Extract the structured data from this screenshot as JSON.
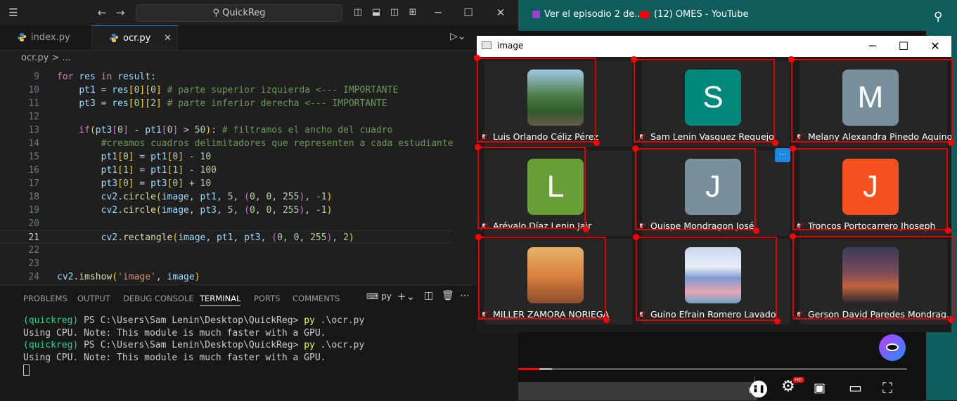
{
  "vscode": {
    "search_text": "QuickReg",
    "tabs": [
      {
        "label": "index.py"
      },
      {
        "label": "ocr.py"
      }
    ],
    "breadcrumb": "ocr.py > ...",
    "line_numbers": [
      "9",
      "10",
      "11",
      "12",
      "13",
      "14",
      "15",
      "16",
      "17",
      "18",
      "19",
      "20",
      "21",
      "22",
      "23",
      "24"
    ],
    "panel_tabs": [
      "PROBLEMS",
      "OUTPUT",
      "DEBUG CONSOLE",
      "TERMINAL",
      "PORTS",
      "COMMENTS"
    ],
    "terminal_shell": "py",
    "terminal": {
      "env": "(quickreg)",
      "prompt": "PS C:\\Users\\Sam Lenin\\Desktop\\QuickReg>",
      "cmd_exe": "py",
      "cmd_arg": ".\\ocr.py",
      "output": "Using CPU. Note: This module is much faster with a GPU."
    }
  },
  "browser": {
    "bookmark1": "Ver el episodio 2 de...",
    "bookmark2": "(12) OMES - YouTube"
  },
  "image_window": {
    "title": "image",
    "participants": [
      {
        "name": "Luis Orlando Céliz Pérez",
        "type": "photo",
        "icon": "mountain-photo"
      },
      {
        "name": "Sam Lenin Vasquez Requejo",
        "type": "letter",
        "letter": "S",
        "color": "#00897b"
      },
      {
        "name": "Melany Alexandra Pinedo Aquino",
        "type": "letter",
        "letter": "M",
        "color": "#78909c"
      },
      {
        "name": "Arévalo Díaz Lenin Jair",
        "type": "letter",
        "letter": "L",
        "color": "#689f38"
      },
      {
        "name": "Quispe Mondragon José",
        "type": "letter",
        "letter": "J",
        "color": "#78909c"
      },
      {
        "name": "Troncos Portocarrero Jhoseph",
        "type": "letter",
        "letter": "J",
        "color": "#f4511e"
      },
      {
        "name": "MILLER ZAMORA NORIEGA",
        "type": "photo",
        "icon": "cartoon-photo"
      },
      {
        "name": "Guino Efrain Romero Lavado",
        "type": "photo",
        "icon": "mount-fuji-photo"
      },
      {
        "name": "Gerson David Paredes Mondrag...",
        "type": "photo",
        "icon": "night-scene-photo"
      }
    ]
  },
  "colors": {
    "rect": "#e00000",
    "accent": "#0078d4"
  }
}
